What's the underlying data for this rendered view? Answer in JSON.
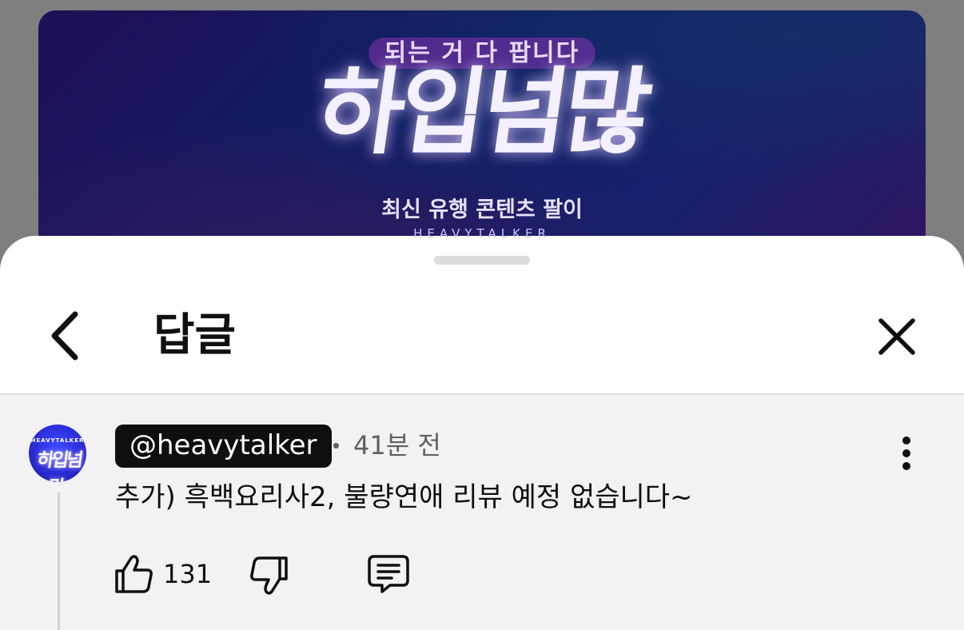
{
  "video_banner": {
    "top_text": "되는 거 다 팝니다",
    "logo_text": "하입넘많",
    "subtitle": "최신 유행 콘텐츠 팔이",
    "brand": "HEAVYTALKER"
  },
  "sheet": {
    "title": "답글",
    "back_icon": "chevron-left-icon",
    "close_icon": "close-icon"
  },
  "comment": {
    "avatar_top": "HEAVYTALKER",
    "avatar_main": "하입넘많",
    "author": "@heavytalker",
    "timestamp": "41분 전",
    "text": "추가) 흑백요리사2, 불량연애 리뷰 예정 없습니다~",
    "like_count": "131",
    "icons": {
      "like": "thumbs-up-icon",
      "dislike": "thumbs-down-icon",
      "reply": "reply-icon",
      "more": "more-vert-icon"
    }
  }
}
